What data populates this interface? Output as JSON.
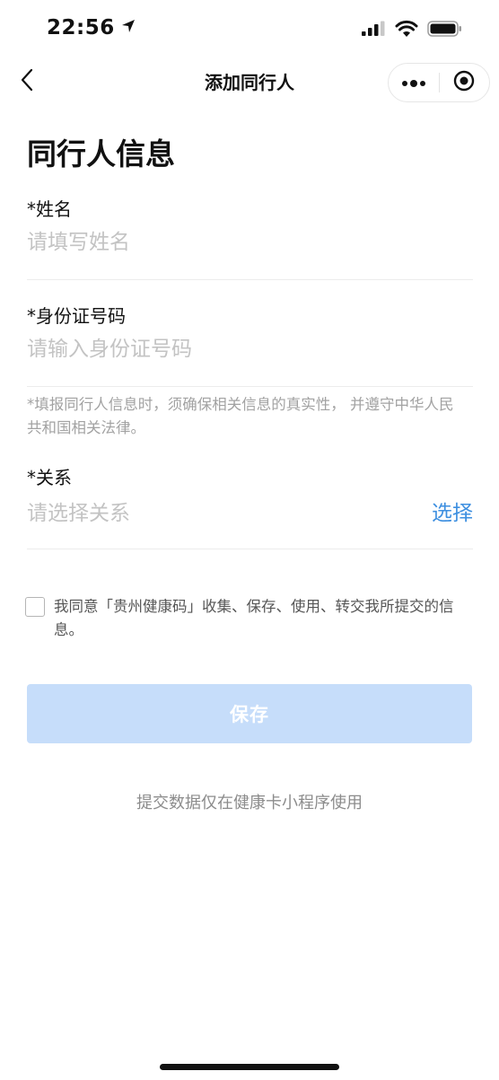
{
  "status_bar": {
    "time": "22:56"
  },
  "nav": {
    "title": "添加同行人"
  },
  "page": {
    "title": "同行人信息"
  },
  "form": {
    "name": {
      "label": "*姓名",
      "placeholder": "请填写姓名",
      "value": ""
    },
    "id_number": {
      "label": "*身份证号码",
      "placeholder": "请输入身份证号码",
      "value": ""
    },
    "notice": "*填报同行人信息时，须确保相关信息的真实性， 并遵守中华人民共和国相关法律。",
    "relation": {
      "label": "*关系",
      "placeholder": "请选择关系",
      "select_label": "选择"
    }
  },
  "agreement": {
    "text": "我同意「贵州健康码」收集、保存、使用、转交我所提交的信息。",
    "checked": false
  },
  "actions": {
    "save_label": "保存"
  },
  "footer": {
    "note": "提交数据仅在健康卡小程序使用"
  },
  "colors": {
    "accent": "#3d8fe0",
    "save_button_disabled": "#c6ddfa",
    "placeholder": "#c3c3c3",
    "notice_text": "#a2a2a2"
  }
}
